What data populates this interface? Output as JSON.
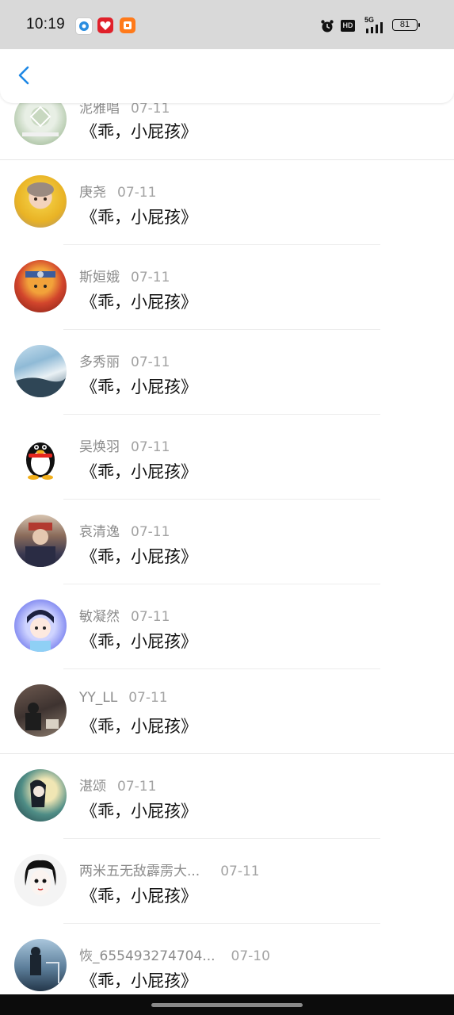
{
  "status_bar": {
    "time": "10:19",
    "hd": "HD",
    "network": "5G",
    "battery": "81",
    "icons": [
      "alarm-icon",
      "hd-icon",
      "signal-icon",
      "battery-icon"
    ]
  },
  "header": {
    "back_icon": "chevron-left-icon",
    "accent": "#1e88e5"
  },
  "comments": [
    {
      "name": "泥雅唱",
      "date": "07-11",
      "text": "《乖，小屁孩》"
    },
    {
      "name": "庚尧",
      "date": "07-11",
      "text": "《乖，小屁孩》"
    },
    {
      "name": "斯姮娥",
      "date": "07-11",
      "text": "《乖，小屁孩》"
    },
    {
      "name": "多秀丽",
      "date": "07-11",
      "text": "《乖，小屁孩》"
    },
    {
      "name": "吴焕羽",
      "date": "07-11",
      "text": "《乖，小屁孩》"
    },
    {
      "name": "哀清逸",
      "date": "07-11",
      "text": "《乖，小屁孩》"
    },
    {
      "name": "敏凝然",
      "date": "07-11",
      "text": "《乖，小屁孩》"
    },
    {
      "name": "YY_LL",
      "date": "07-11",
      "text": "《乖，小屁孩》"
    },
    {
      "name": "湛颂",
      "date": "07-11",
      "text": "《乖，小屁孩》"
    },
    {
      "name": "两米五无敌霹雳大...",
      "date": "07-11",
      "text": "《乖，小屁孩》"
    },
    {
      "name": "恢_655493274704...",
      "date": "07-10",
      "text": "《乖，小屁孩》"
    }
  ]
}
